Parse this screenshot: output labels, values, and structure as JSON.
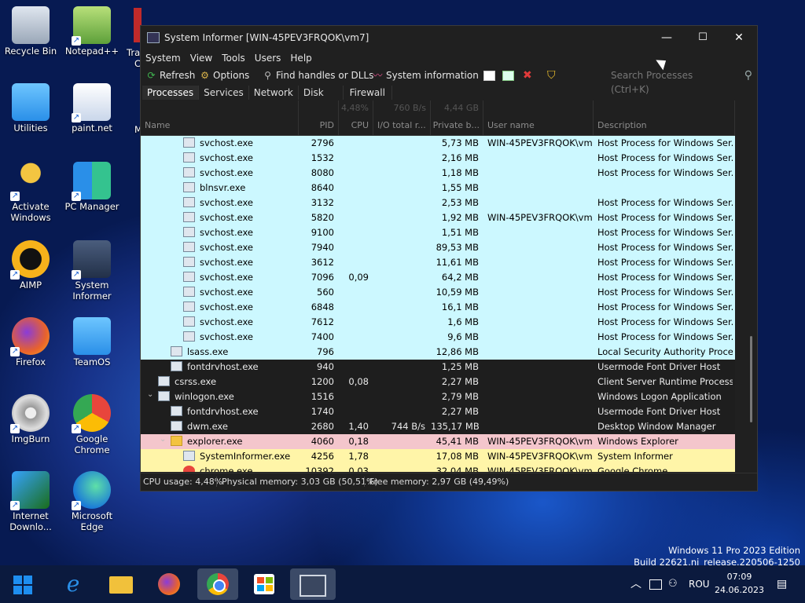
{
  "desktop": {
    "icons": [
      {
        "label": "Recycle Bin",
        "icon": "recycle-bin-icon"
      },
      {
        "label": "Notepad++",
        "icon": "notepadpp-icon"
      },
      {
        "label": "Utilities",
        "icon": "folder-icon"
      },
      {
        "label": "paint.net",
        "icon": "paintnet-icon"
      },
      {
        "label": "Activate Windows",
        "icon": "key-icon"
      },
      {
        "label": "PC Manager",
        "icon": "pc-manager-icon"
      },
      {
        "label": "AIMP",
        "icon": "aimp-icon"
      },
      {
        "label": "System Informer",
        "icon": "system-informer-icon"
      },
      {
        "label": "Firefox",
        "icon": "firefox-icon"
      },
      {
        "label": "TeamOS",
        "icon": "folder-icon"
      },
      {
        "label": "ImgBurn",
        "icon": "imgburn-icon"
      },
      {
        "label": "Google Chrome",
        "icon": "chrome-icon"
      },
      {
        "label": "Internet Downlo...",
        "icon": "idm-icon"
      },
      {
        "label": "Microsoft Edge",
        "icon": "edge-icon"
      }
    ],
    "partial_labels": [
      "Tra",
      "C",
      "M",
      "M"
    ]
  },
  "window": {
    "title": "System Informer [WIN-45PEV3FRQOK\\vm7]",
    "controls": {
      "minimize": "—",
      "maximize": "☐",
      "close": "✕"
    },
    "menu": [
      "System",
      "View",
      "Tools",
      "Users",
      "Help"
    ],
    "toolbar": {
      "refresh": "Refresh",
      "options": "Options",
      "find_handles": "Find handles or DLLs",
      "system_information": "System information"
    },
    "search_placeholder": "Search Processes (Ctrl+K)",
    "tabs": [
      "Processes",
      "Services",
      "Network",
      "Disk",
      "Firewall"
    ],
    "columns": {
      "name": "Name",
      "pid": "PID",
      "cpu": "CPU",
      "io": "I/O total r...",
      "private": "Private b...",
      "user": "User name",
      "desc": "Description"
    },
    "totals": {
      "cpu": "4,48%",
      "io": "760 B/s",
      "private": "4,44 GB"
    },
    "processes": [
      {
        "name": "svchost.exe",
        "pid": "2796",
        "cpu": "",
        "io": "",
        "private": "5,73 MB",
        "user": "WIN-45PEV3FRQOK\\vm7",
        "desc": "Host Process for Windows Ser...",
        "style": "svc",
        "level": 3
      },
      {
        "name": "svchost.exe",
        "pid": "1532",
        "cpu": "",
        "io": "",
        "private": "2,16 MB",
        "user": "",
        "desc": "Host Process for Windows Ser...",
        "style": "svc",
        "level": 3
      },
      {
        "name": "svchost.exe",
        "pid": "8080",
        "cpu": "",
        "io": "",
        "private": "1,18 MB",
        "user": "",
        "desc": "Host Process for Windows Ser...",
        "style": "svc",
        "level": 3
      },
      {
        "name": "blnsvr.exe",
        "pid": "8640",
        "cpu": "",
        "io": "",
        "private": "1,55 MB",
        "user": "",
        "desc": "",
        "style": "svc",
        "level": 3
      },
      {
        "name": "svchost.exe",
        "pid": "3132",
        "cpu": "",
        "io": "",
        "private": "2,53 MB",
        "user": "",
        "desc": "Host Process for Windows Ser...",
        "style": "svc",
        "level": 3
      },
      {
        "name": "svchost.exe",
        "pid": "5820",
        "cpu": "",
        "io": "",
        "private": "1,92 MB",
        "user": "WIN-45PEV3FRQOK\\vm7",
        "desc": "Host Process for Windows Ser...",
        "style": "svc",
        "level": 3
      },
      {
        "name": "svchost.exe",
        "pid": "9100",
        "cpu": "",
        "io": "",
        "private": "1,51 MB",
        "user": "",
        "desc": "Host Process for Windows Ser...",
        "style": "svc",
        "level": 3
      },
      {
        "name": "svchost.exe",
        "pid": "7940",
        "cpu": "",
        "io": "",
        "private": "89,53 MB",
        "user": "",
        "desc": "Host Process for Windows Ser...",
        "style": "svc",
        "level": 3
      },
      {
        "name": "svchost.exe",
        "pid": "3612",
        "cpu": "",
        "io": "",
        "private": "11,61 MB",
        "user": "",
        "desc": "Host Process for Windows Ser...",
        "style": "svc",
        "level": 3
      },
      {
        "name": "svchost.exe",
        "pid": "7096",
        "cpu": "0,09",
        "io": "",
        "private": "64,2 MB",
        "user": "",
        "desc": "Host Process for Windows Ser...",
        "style": "svc",
        "level": 3
      },
      {
        "name": "svchost.exe",
        "pid": "560",
        "cpu": "",
        "io": "",
        "private": "10,59 MB",
        "user": "",
        "desc": "Host Process for Windows Ser...",
        "style": "svc",
        "level": 3
      },
      {
        "name": "svchost.exe",
        "pid": "6848",
        "cpu": "",
        "io": "",
        "private": "16,1 MB",
        "user": "",
        "desc": "Host Process for Windows Ser...",
        "style": "svc",
        "level": 3
      },
      {
        "name": "svchost.exe",
        "pid": "7612",
        "cpu": "",
        "io": "",
        "private": "1,6 MB",
        "user": "",
        "desc": "Host Process for Windows Ser...",
        "style": "svc",
        "level": 3
      },
      {
        "name": "svchost.exe",
        "pid": "7400",
        "cpu": "",
        "io": "",
        "private": "9,6 MB",
        "user": "",
        "desc": "Host Process for Windows Ser...",
        "style": "svc",
        "level": 3
      },
      {
        "name": "lsass.exe",
        "pid": "796",
        "cpu": "",
        "io": "",
        "private": "12,86 MB",
        "user": "",
        "desc": "Local Security Authority Process",
        "style": "svc",
        "level": 2
      },
      {
        "name": "fontdrvhost.exe",
        "pid": "940",
        "cpu": "",
        "io": "",
        "private": "1,25 MB",
        "user": "",
        "desc": "Usermode Font Driver Host",
        "style": "norm",
        "level": 2
      },
      {
        "name": "csrss.exe",
        "pid": "1200",
        "cpu": "0,08",
        "io": "",
        "private": "2,27 MB",
        "user": "",
        "desc": "Client Server Runtime Process",
        "style": "norm",
        "level": 1
      },
      {
        "name": "winlogon.exe",
        "pid": "1516",
        "cpu": "",
        "io": "",
        "private": "2,79 MB",
        "user": "",
        "desc": "Windows Logon Application",
        "style": "norm",
        "level": 1,
        "expanded": true
      },
      {
        "name": "fontdrvhost.exe",
        "pid": "1740",
        "cpu": "",
        "io": "",
        "private": "2,27 MB",
        "user": "",
        "desc": "Usermode Font Driver Host",
        "style": "norm",
        "level": 2
      },
      {
        "name": "dwm.exe",
        "pid": "2680",
        "cpu": "1,40",
        "io": "744 B/s",
        "private": "135,17 MB",
        "user": "",
        "desc": "Desktop Window Manager",
        "style": "norm",
        "level": 2
      },
      {
        "name": "explorer.exe",
        "pid": "4060",
        "cpu": "0,18",
        "io": "",
        "private": "45,41 MB",
        "user": "WIN-45PEV3FRQOK\\vm7",
        "desc": "Windows Explorer",
        "style": "own",
        "level": 2,
        "expanded": true,
        "icon": "fold"
      },
      {
        "name": "SystemInformer.exe",
        "pid": "4256",
        "cpu": "1,78",
        "io": "",
        "private": "17,08 MB",
        "user": "WIN-45PEV3FRQOK\\vm7",
        "desc": "System Informer",
        "style": "self",
        "level": 3
      },
      {
        "name": "chrome.exe",
        "pid": "10392",
        "cpu": "0,03",
        "io": "",
        "private": "32,04 MB",
        "user": "WIN-45PEV3FRQOK\\vm7",
        "desc": "Google Chrome",
        "style": "self",
        "level": 3,
        "icon": "chrome"
      }
    ],
    "status": {
      "cpu": "CPU usage: 4,48%",
      "physical": "Physical memory: 3,03 GB (50,51%)",
      "free": "Free memory: 2,97 GB (49,49%)"
    }
  },
  "watermark": {
    "line1": "Windows 11 Pro 2023 Edition",
    "line2": "Build 22621.ni_release.220506-1250"
  },
  "taskbar": {
    "tray_lang": "ROU",
    "time": "07:09",
    "date": "24.06.2023"
  }
}
